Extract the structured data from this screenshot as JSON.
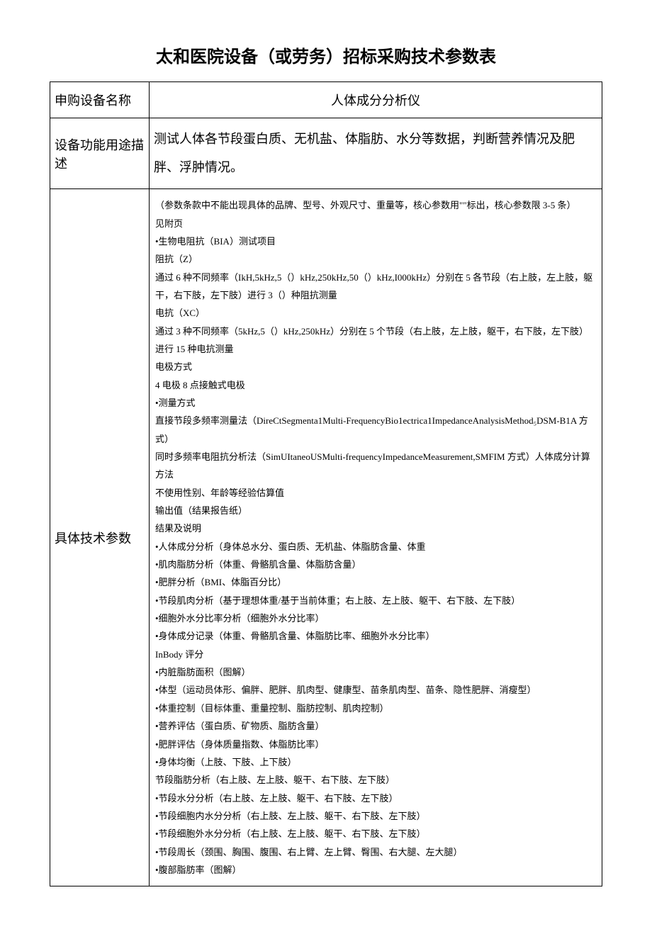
{
  "title": "太和医院设备（或劳务）招标采购技术参数表",
  "rows": {
    "device_name_label": "申购设备名称",
    "device_name_value": "人体成分分析仪",
    "function_label": "设备功能用途描述",
    "function_value": "测试人体各节段蛋白质、无机盐、体脂肪、水分等数据，判断营养情况及肥胖、浮肿情况。",
    "param_label": "具体技术参数"
  },
  "params": [
    "（参数条款中不能出现具体的品牌、型号、外观尺寸、重量等，核心参数用\"\"标出，核心参数限 3-5 条）",
    "见附页",
    "•生物电阻抗（BIA）测试项目",
    "阻抗（Z）",
    "通过 6 种不同频率（IkH,5kHz,5（）kHz,250kHz,50（）kHz,I000kHz）分别在 5 各节段（右上肢，左上肢，躯干，右下肢，左下肢）进行 3（）种阻抗测量",
    "电抗（XC）",
    "通过 3 种不同频率（5kHz,5（）kHz,250kHz）分别在 5 个节段（右上肢，左上肢，躯干，右下肢，左下肢）进行 15 种电抗测量",
    "电极方式",
    "4 电极 8 点接触式电极",
    "•测量方式",
    "直接节段多频率测量法（DireCtSegmenta1Multi-FrequencyBio1ectrica1ImpedanceAnalysisMethod₅DSM-B1A 方式）",
    "同时多频率电阻抗分析法（SimUItaneoUSMulti-frequencyImpedanceMeasurement,SMFIM 方式）人体成分计算方法",
    "不使用性别、年龄等经验估算值",
    "输出值（结果报告纸）",
    "结果及说明",
    "•人体成分分析（身体总水分、蛋白质、无机盐、体脂肪含量、体重",
    "•肌肉脂肪分析（体重、骨骼肌含量、体脂肪含量）",
    "•肥胖分析（BMI、体脂百分比）",
    "•节段肌肉分析（基于理想体重/基于当前体重；右上肢、左上肢、躯干、右下肢、左下肢）",
    "•细胞外水分比率分析（细胞外水分比率）",
    "•身体成分记录（体重、骨骼肌含量、体脂肪比率、细胞外水分比率）",
    "InBody 评分",
    "•内脏脂肪面积（图解）",
    "•体型（运动员体形、偏胖、肥胖、肌肉型、健康型、苗条肌肉型、苗条、隐性肥胖、消瘦型）",
    "•体重控制（目标体重、重量控制、脂肪控制、肌肉控制）",
    "•营养评估（蛋白质、矿物质、脂肪含量）",
    "•肥胖评估（身体质量指数、体脂肪比率）",
    "•身体均衡（上肢、下肢、上下肢）",
    "节段脂肪分析（右上肢、左上肢、躯干、右下肢、左下肢）",
    "•节段水分分析（右上肢、左上肢、躯干、右下肢、左下肢）",
    "•节段细胞内水分分析（右上肢、左上肢、躯干、右下肢、左下肢）",
    "•节段细胞外水分分析（右上肢、左上肢、躯干、右下肢、左下肢）",
    "•节段周长（颈围、胸围、腹围、右上臂、左上臂、臀围、右大腿、左大腿）",
    "•腹部脂肪率（图解）"
  ]
}
